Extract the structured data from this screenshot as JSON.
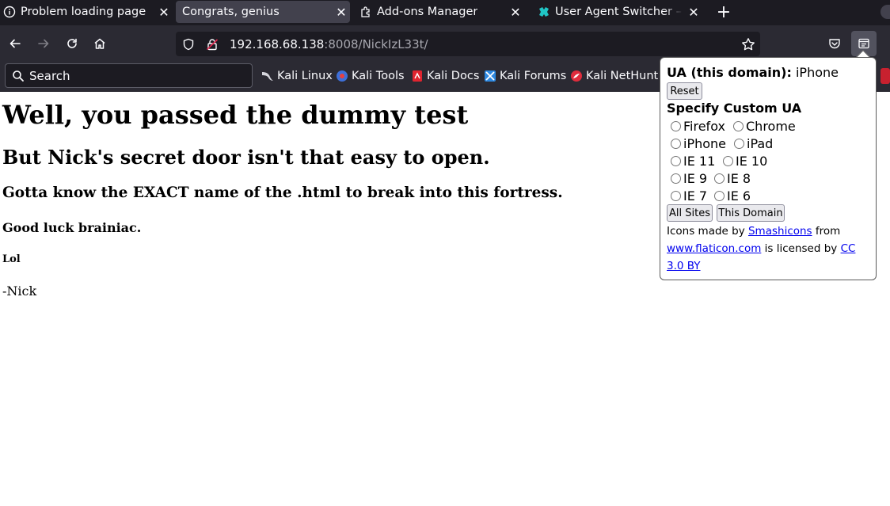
{
  "tabs": [
    {
      "title": "Problem loading page",
      "icon": "info-icon",
      "active": false
    },
    {
      "title": "Congrats, genius",
      "icon": "none",
      "active": true
    },
    {
      "title": "Add-ons Manager",
      "icon": "puzzle-icon",
      "active": false
    },
    {
      "title": "User Agent Switcher – Get",
      "icon": "ua-switcher-icon",
      "active": false
    }
  ],
  "urlbar": {
    "host": "192.168.68.138",
    "rest": ":8008/NickIzL33t/"
  },
  "search": {
    "placeholder": "Search"
  },
  "bookmarks": [
    {
      "label": "Kali Linux",
      "icon": "kali-dragon-icon"
    },
    {
      "label": "Kali Tools",
      "icon": "kali-tools-icon"
    },
    {
      "label": "Kali Docs",
      "icon": "kali-docs-icon"
    },
    {
      "label": "Kali Forums",
      "icon": "kali-forums-icon"
    },
    {
      "label": "Kali NetHunter",
      "icon": "kali-nethunter-icon"
    }
  ],
  "page": {
    "h1": "Well, you passed the dummy test",
    "h2": "But Nick's secret door isn't that easy to open.",
    "h3": "Gotta know the EXACT name of the .html to break into this fortress.",
    "h4": "Good luck brainiac.",
    "h5": "Lol",
    "sig": "-Nick"
  },
  "popup": {
    "ua_label": "UA (this domain):",
    "ua_value": "iPhone",
    "reset_label": "Reset",
    "custom_title": "Specify Custom UA",
    "options": [
      "Firefox",
      "Chrome",
      "iPhone",
      "iPad",
      "IE 11",
      "IE 10",
      "IE 9",
      "IE 8",
      "IE 7",
      "IE 6"
    ],
    "all_sites_label": "All Sites",
    "this_domain_label": "This Domain",
    "credit": {
      "prefix": "Icons made by ",
      "author": "Smashicons",
      "mid1": " from",
      "site": "www.flaticon.com",
      "mid2": " is licensed by ",
      "license": "CC 3.0 BY"
    }
  },
  "colors": {
    "tabbar_bg": "#1c1b22",
    "toolbar_bg": "#2b2a33",
    "active_tab_bg": "#42414d",
    "link": "#0000ee"
  }
}
